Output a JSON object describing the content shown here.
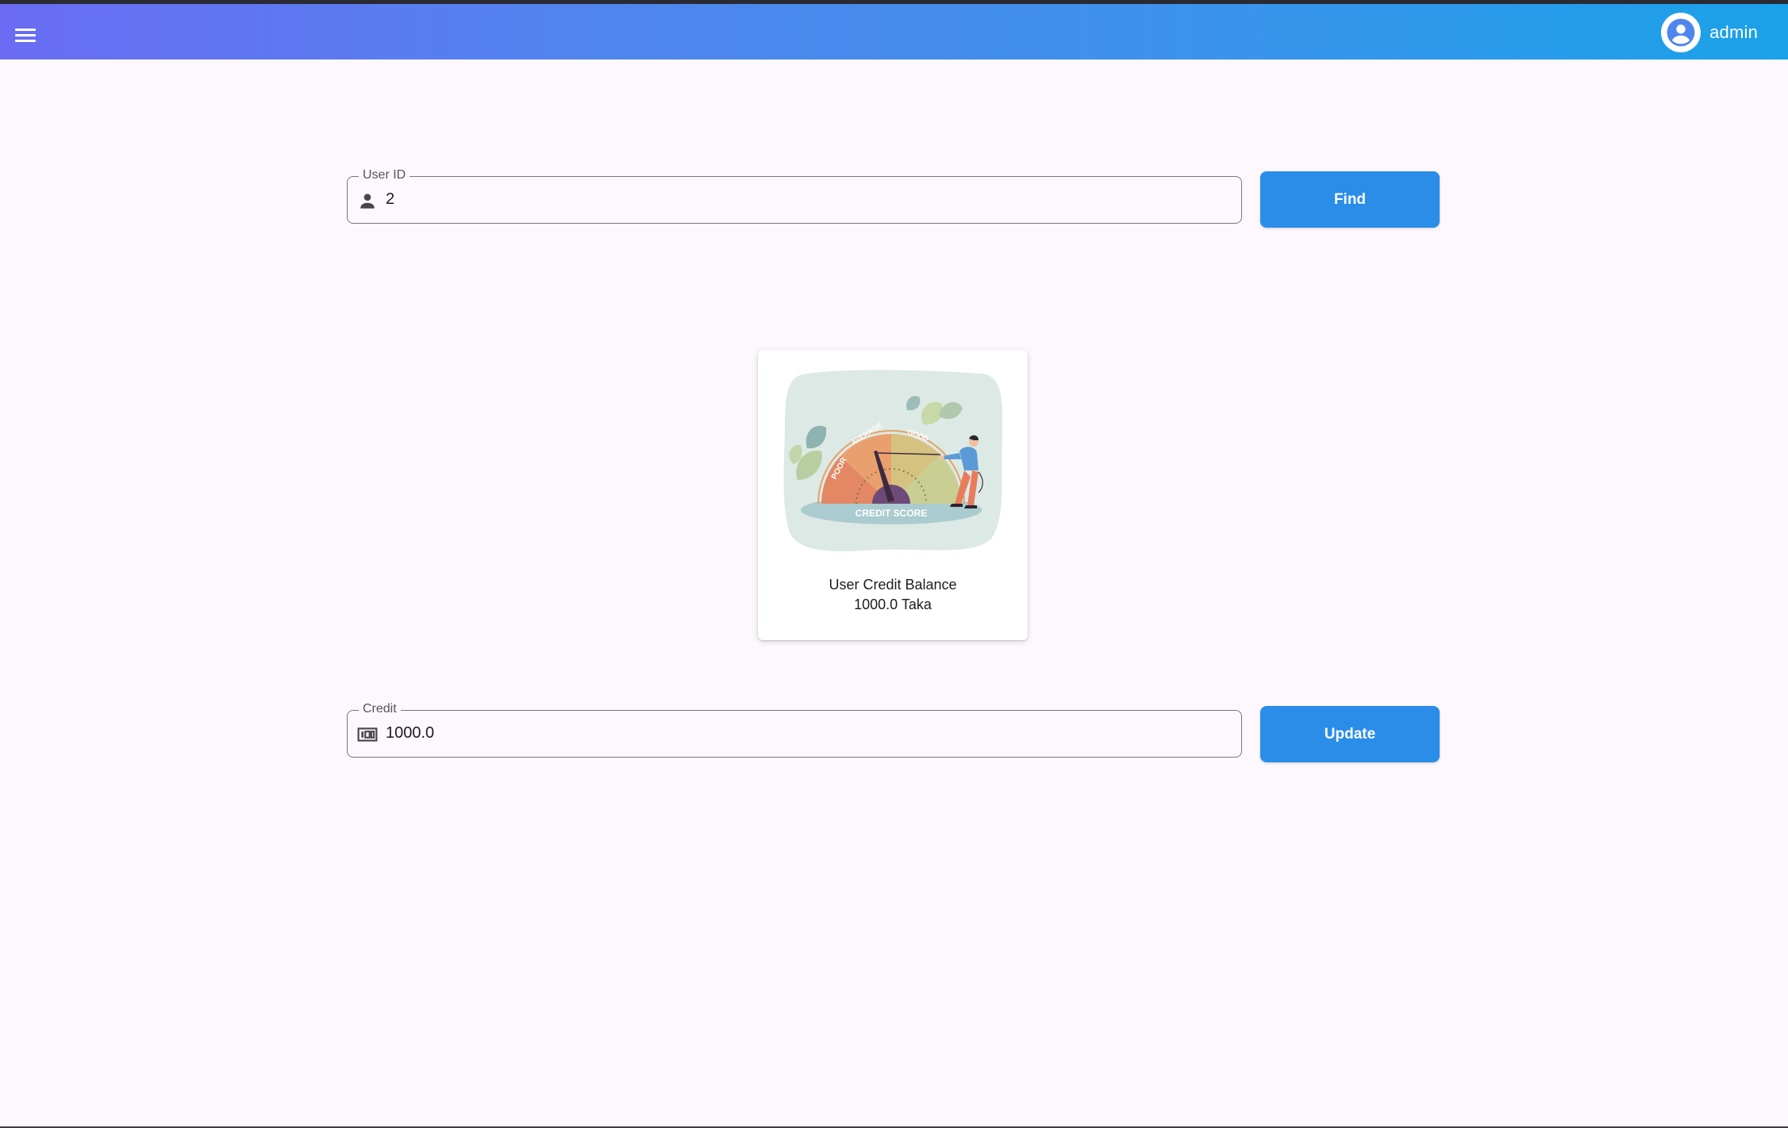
{
  "header": {
    "username": "admin",
    "menu_icon": "hamburger-menu-icon",
    "avatar_icon": "account-circle-icon",
    "gradient_start": "#6a6cf3",
    "gradient_end": "#1aa2e8"
  },
  "find_form": {
    "label": "User ID",
    "value": "2",
    "icon": "person-icon",
    "button_label": "Find"
  },
  "credit_card": {
    "image": "credit-score-illustration",
    "gauge_labels": [
      "POOR",
      "AVERAGE",
      "GOOD"
    ],
    "gauge_caption": "CREDIT SCORE",
    "title": "User Credit Balance",
    "value": "1000.0 Taka"
  },
  "update_form": {
    "label": "Credit",
    "value": "1000.0",
    "icon": "money-icon",
    "button_label": "Update"
  },
  "colors": {
    "primary_button": "#2a8de8",
    "background": "#fdf8fd"
  }
}
